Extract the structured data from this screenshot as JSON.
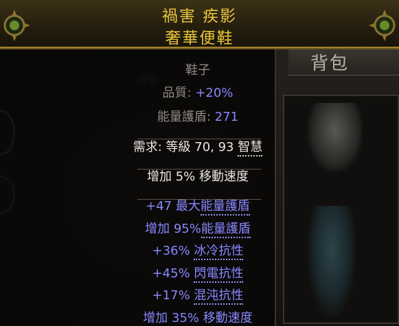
{
  "background": {
    "inventory_title": "背包",
    "ghost_label": "背包"
  },
  "item": {
    "name": "禍害 疾影",
    "base_type": "奢華便鞋",
    "item_class": "鞋子",
    "quality_label": "品質: ",
    "quality_value": "+20%",
    "energy_shield_label": "能量護盾: ",
    "energy_shield_value": "271",
    "requirement_prefix": "需求: 等級 70, 93 ",
    "requirement_stat": "智慧",
    "implicit_mod": "增加 5% 移動速度",
    "explicit_mods": [
      {
        "prefix": "+47 最大",
        "keyword": "能量護盾",
        "suffix": ""
      },
      {
        "prefix": "增加 95%",
        "keyword": "能量護盾",
        "suffix": ""
      },
      {
        "prefix": "+36% ",
        "keyword": "冰冷抗性",
        "suffix": ""
      },
      {
        "prefix": "+45% ",
        "keyword": "閃電抗性",
        "suffix": ""
      },
      {
        "prefix": "+17% ",
        "keyword": "混沌抗性",
        "suffix": ""
      },
      {
        "prefix": "增加 35% 移動速度",
        "keyword": "",
        "suffix": ""
      }
    ]
  },
  "colors": {
    "rare_name": "#e8c53a",
    "magic_blue": "#8888ff",
    "header_border": "#a57f2d"
  }
}
